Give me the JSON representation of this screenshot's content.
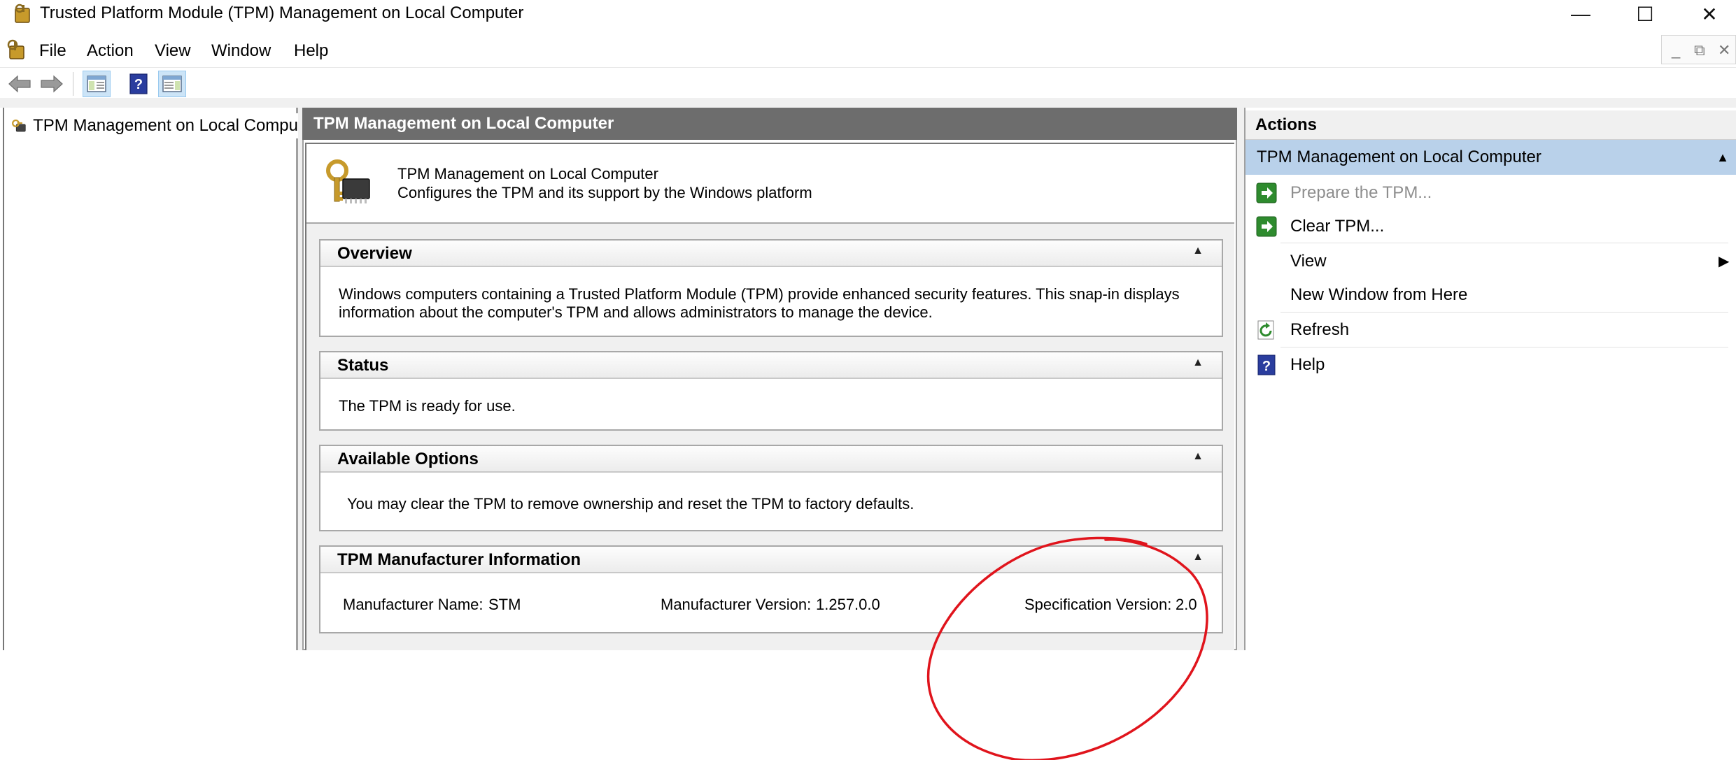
{
  "window": {
    "title": "Trusted Platform Module (TPM) Management on Local Computer",
    "minimize_glyph": "—",
    "maximize_glyph": "☐",
    "close_glyph": "✕"
  },
  "menu": {
    "items": [
      "File",
      "Action",
      "View",
      "Window",
      "Help"
    ],
    "mdi_minimize": "_",
    "mdi_restore": "⧉",
    "mdi_close": "✕"
  },
  "toolbar": {
    "icons": [
      "back-arrow-icon",
      "forward-arrow-icon",
      "show-hide-console-tree-icon",
      "help-icon",
      "show-hide-action-pane-icon"
    ]
  },
  "tree": {
    "root_label": "TPM Management on Local Compu"
  },
  "center": {
    "header": "TPM Management on Local Computer",
    "snapin_title": "TPM Management on Local Computer",
    "snapin_description": "Configures the TPM and its support by the Windows platform",
    "sections": {
      "overview": {
        "title": "Overview",
        "line1": "Windows computers containing a Trusted Platform Module (TPM) provide enhanced security features. This snap-in displays",
        "line2": "information about the computer's TPM and allows administrators to manage the device."
      },
      "status": {
        "title": "Status",
        "text": "The TPM is ready for use."
      },
      "options": {
        "title": "Available Options",
        "text": "You may clear the TPM to remove ownership and reset the TPM to factory defaults."
      },
      "manufacturer": {
        "title": "TPM Manufacturer Information",
        "name_label": "Manufacturer Name:",
        "name_value": "STM",
        "version_label": "Manufacturer Version:",
        "version_value": "1.257.0.0",
        "spec_label": "Specification Version:",
        "spec_value": "2.0"
      }
    }
  },
  "actions": {
    "header": "Actions",
    "group_title": "TPM Management on Local Computer",
    "items": [
      {
        "label": "Prepare the TPM...",
        "enabled": false,
        "icon": "green-arrow-icon"
      },
      {
        "label": "Clear TPM...",
        "enabled": true,
        "icon": "green-arrow-icon"
      },
      {
        "label": "View",
        "enabled": true,
        "icon": "",
        "submenu": true
      },
      {
        "label": "New Window from Here",
        "enabled": true,
        "icon": ""
      },
      {
        "label": "Refresh",
        "enabled": true,
        "icon": "refresh-icon"
      },
      {
        "label": "Help",
        "enabled": true,
        "icon": "help-icon"
      }
    ]
  },
  "annotation": {
    "shape": "hand-drawn-circle",
    "color": "#e0141c"
  },
  "colors": {
    "header_gray": "#6d6d6d",
    "actions_group_blue": "#b9d1ea",
    "annotation_red": "#e0141c"
  }
}
